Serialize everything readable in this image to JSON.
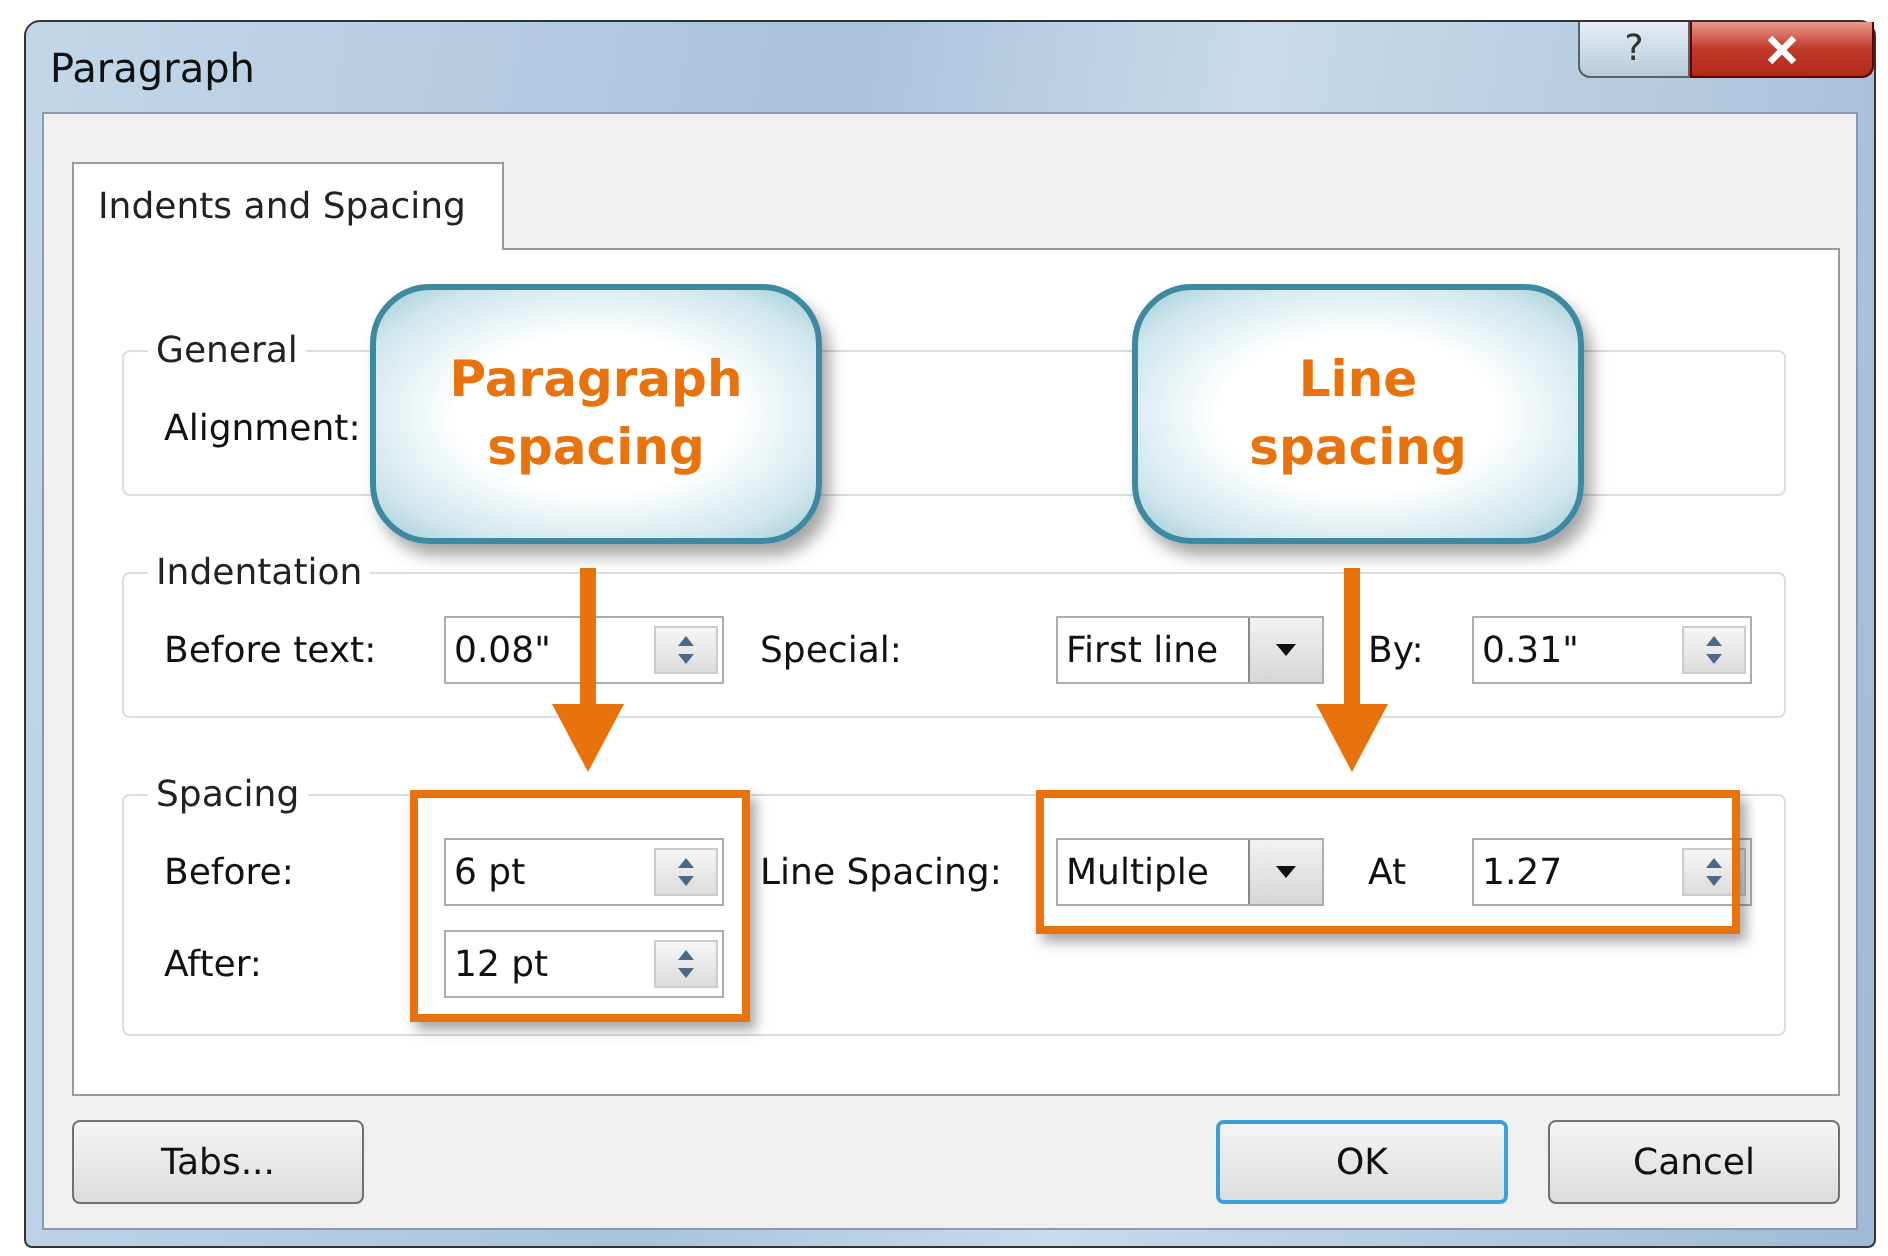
{
  "window": {
    "title": "Paragraph",
    "help_button": "?"
  },
  "tabs": [
    {
      "label": "Indents and Spacing",
      "selected": true
    }
  ],
  "groups": [
    {
      "title": "General",
      "rows": [
        [
          {
            "kind": "label",
            "text": "Alignment:"
          }
        ]
      ]
    },
    {
      "title": "Indentation",
      "rows": [
        [
          {
            "kind": "label",
            "text": "Before text:"
          },
          {
            "kind": "spin",
            "value": "0.08\""
          },
          {
            "kind": "label",
            "text": "Special:"
          },
          {
            "kind": "dropdown",
            "value": "First line"
          },
          {
            "kind": "label",
            "text": "By:"
          },
          {
            "kind": "spin",
            "value": "0.31\""
          }
        ]
      ]
    },
    {
      "title": "Spacing",
      "rows": [
        [
          {
            "kind": "label",
            "text": "Before:"
          },
          {
            "kind": "spin",
            "value": "6 pt"
          },
          {
            "kind": "label",
            "text": "Line Spacing:"
          },
          {
            "kind": "dropdown",
            "value": "Multiple"
          },
          {
            "kind": "label",
            "text": "At"
          },
          {
            "kind": "spin",
            "value": "1.27"
          }
        ],
        [
          {
            "kind": "label",
            "text": "After:"
          },
          {
            "kind": "spin",
            "value": "12 pt"
          }
        ]
      ]
    }
  ],
  "callouts": [
    {
      "text": "Paragraph spacing"
    },
    {
      "text": "Line spacing"
    }
  ],
  "buttons": [
    {
      "label": "Tabs...",
      "default": false
    },
    {
      "label": "OK",
      "default": true
    },
    {
      "label": "Cancel",
      "default": false
    }
  ]
}
